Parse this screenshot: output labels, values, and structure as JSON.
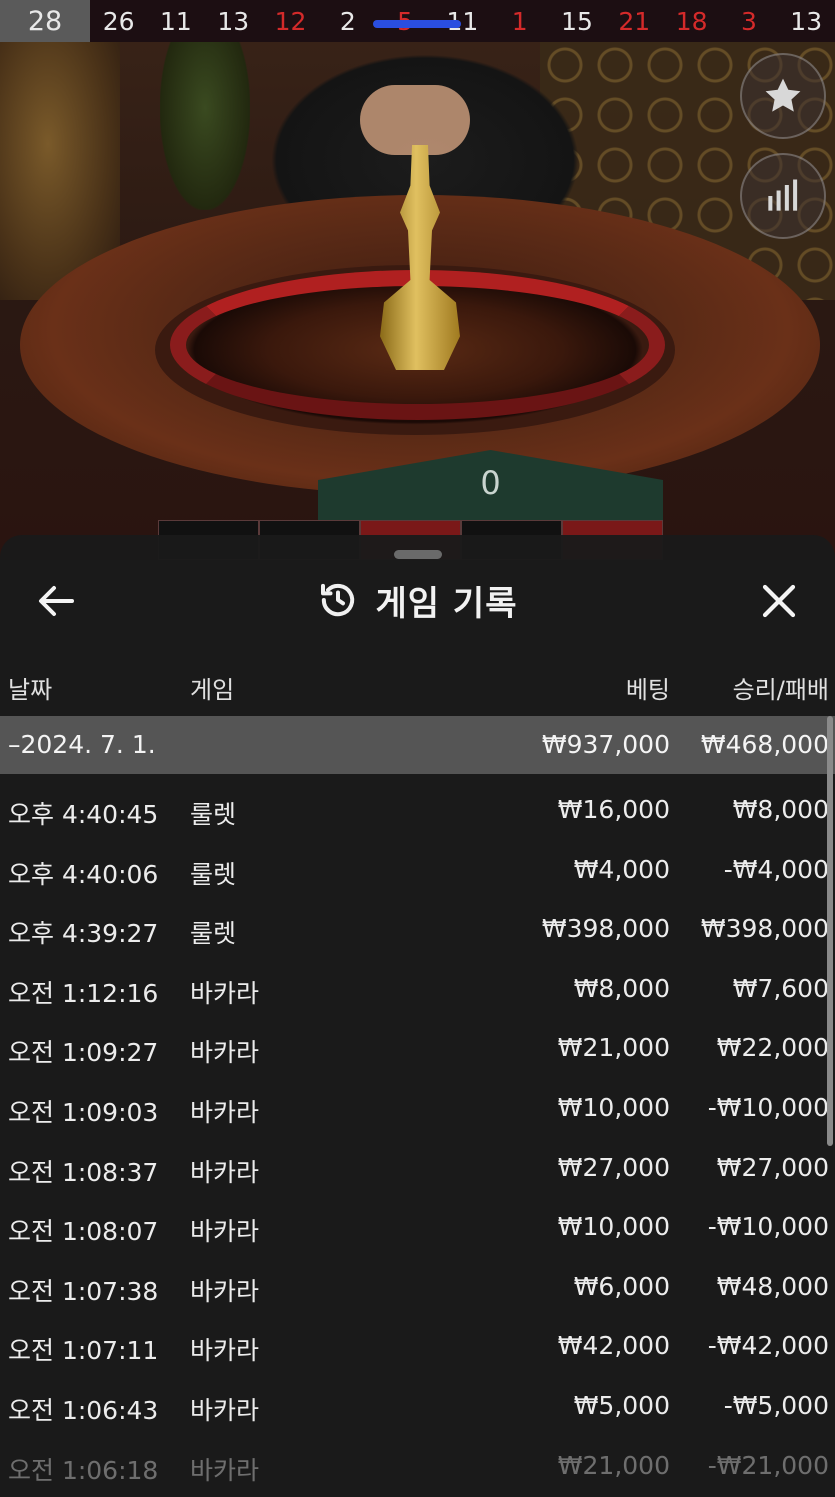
{
  "results_strip": {
    "latest": "28",
    "numbers": [
      {
        "value": "26",
        "color": "black"
      },
      {
        "value": "11",
        "color": "black"
      },
      {
        "value": "13",
        "color": "black"
      },
      {
        "value": "12",
        "color": "red"
      },
      {
        "value": "2",
        "color": "black"
      },
      {
        "value": "5",
        "color": "red"
      },
      {
        "value": "11",
        "color": "black"
      },
      {
        "value": "1",
        "color": "red"
      },
      {
        "value": "15",
        "color": "black"
      },
      {
        "value": "21",
        "color": "red"
      },
      {
        "value": "18",
        "color": "red"
      },
      {
        "value": "3",
        "color": "red"
      },
      {
        "value": "13",
        "color": "black"
      }
    ]
  },
  "table": {
    "zero_label": "0"
  },
  "side_buttons": {
    "favorite_icon": "star-icon",
    "stats_icon": "bar-chart-icon"
  },
  "sheet": {
    "title": "게임 기록",
    "title_icon": "history-icon",
    "back_icon": "arrow-left-icon",
    "close_icon": "close-icon",
    "columns": {
      "date": "날짜",
      "game": "게임",
      "bet": "베팅",
      "win_loss": "승리/패배"
    },
    "day_summary": {
      "date": "–2024. 7. 1.",
      "bet": "₩937,000",
      "win_loss": "₩468,000"
    },
    "rows": [
      {
        "time": "오후 4:40:45",
        "game": "룰렛",
        "bet": "₩16,000",
        "win_loss": "₩8,000"
      },
      {
        "time": "오후 4:40:06",
        "game": "룰렛",
        "bet": "₩4,000",
        "win_loss": "-₩4,000"
      },
      {
        "time": "오후 4:39:27",
        "game": "룰렛",
        "bet": "₩398,000",
        "win_loss": "₩398,000"
      },
      {
        "time": "오전 1:12:16",
        "game": "바카라",
        "bet": "₩8,000",
        "win_loss": "₩7,600"
      },
      {
        "time": "오전 1:09:27",
        "game": "바카라",
        "bet": "₩21,000",
        "win_loss": "₩22,000"
      },
      {
        "time": "오전 1:09:03",
        "game": "바카라",
        "bet": "₩10,000",
        "win_loss": "-₩10,000"
      },
      {
        "time": "오전 1:08:37",
        "game": "바카라",
        "bet": "₩27,000",
        "win_loss": "₩27,000"
      },
      {
        "time": "오전 1:08:07",
        "game": "바카라",
        "bet": "₩10,000",
        "win_loss": "-₩10,000"
      },
      {
        "time": "오전 1:07:38",
        "game": "바카라",
        "bet": "₩6,000",
        "win_loss": "₩48,000"
      },
      {
        "time": "오전 1:07:11",
        "game": "바카라",
        "bet": "₩42,000",
        "win_loss": "-₩42,000"
      },
      {
        "time": "오전 1:06:43",
        "game": "바카라",
        "bet": "₩5,000",
        "win_loss": "-₩5,000"
      },
      {
        "time": "오전 1:06:18",
        "game": "바카라",
        "bet": "₩21,000",
        "win_loss": "-₩21,000"
      }
    ]
  },
  "colors": {
    "red_number": "#d42a2a",
    "progress": "#2a4ee0",
    "summary_row": "#555555"
  }
}
